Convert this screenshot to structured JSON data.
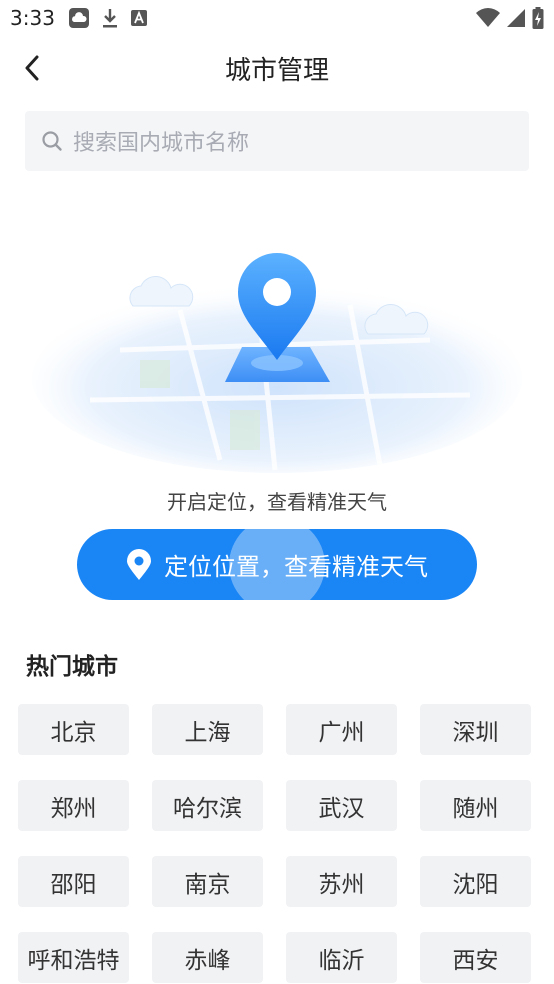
{
  "status_bar": {
    "time": "3:33"
  },
  "header": {
    "title": "城市管理"
  },
  "search": {
    "placeholder": "搜索国内城市名称"
  },
  "locate": {
    "tip": "开启定位，查看精准天气",
    "button_label": "定位位置，查看精准天气"
  },
  "hot_cities": {
    "title": "热门城市",
    "cities": [
      "北京",
      "上海",
      "广州",
      "深圳",
      "郑州",
      "哈尔滨",
      "武汉",
      "随州",
      "邵阳",
      "南京",
      "苏州",
      "沈阳",
      "呼和浩特",
      "赤峰",
      "临沂",
      "西安"
    ]
  },
  "colors": {
    "accent": "#1a85f5",
    "chip_bg": "#f1f2f4",
    "search_bg": "#f4f5f7"
  }
}
